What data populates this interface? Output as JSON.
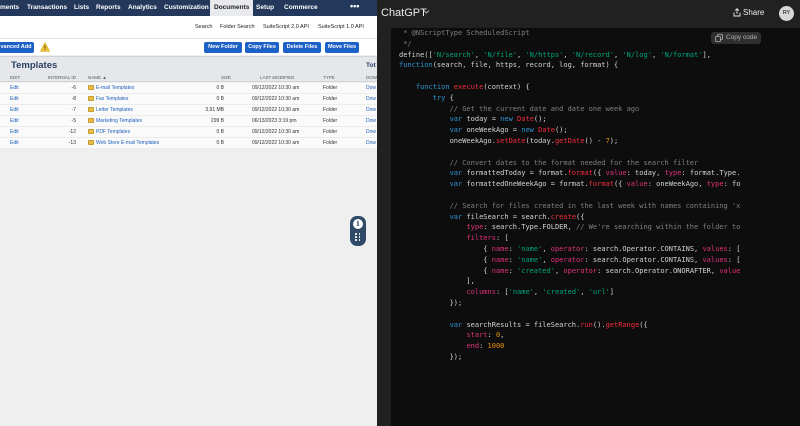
{
  "netsuite": {
    "nav_tabs": [
      "ments",
      "Transactions",
      "Lists",
      "Reports",
      "Analytics",
      "Customization",
      "Documents",
      "Setup",
      "Commerce"
    ],
    "active_tab": "Documents",
    "more_label": "•••",
    "sub_links": [
      "Search",
      "Folder Search",
      "SuiteScript 2.0 API",
      "SuiteScript 1.0 API"
    ],
    "toolbar": {
      "advanced_add": "vanced Add",
      "new_folder": "New Folder",
      "copy_files": "Copy Files",
      "delete_files": "Delete Files",
      "move_files": "Move Files"
    },
    "page_title": "Templates",
    "total_label": "Tot",
    "columns": [
      "EDIT",
      "INTERNAL ID",
      "NAME ▲",
      "SIZE",
      "LAST MODIFIED",
      "TYPE",
      "DOW"
    ],
    "rows": [
      {
        "edit": "Edit",
        "id": "-6",
        "name": "E-mail Templates",
        "size": "0 B",
        "modified": "09/12/2022 10:30 am",
        "type": "Folder",
        "dl": "Dow"
      },
      {
        "edit": "Edit",
        "id": "-8",
        "name": "Fax Templates",
        "size": "0 B",
        "modified": "09/12/2022 10:30 am",
        "type": "Folder",
        "dl": "Dow"
      },
      {
        "edit": "Edit",
        "id": "-7",
        "name": "Letter Templates",
        "size": "3.91 MB",
        "modified": "09/12/2022 10:30 am",
        "type": "Folder",
        "dl": "Dow"
      },
      {
        "edit": "Edit",
        "id": "-5",
        "name": "Marketing Templates",
        "size": "299 B",
        "modified": "06/13/2023 3:19 pm",
        "type": "Folder",
        "dl": "Dow"
      },
      {
        "edit": "Edit",
        "id": "-12",
        "name": "PDF Templates",
        "size": "0 B",
        "modified": "09/12/2022 10:30 am",
        "type": "Folder",
        "dl": "Dow"
      },
      {
        "edit": "Edit",
        "id": "-13",
        "name": "Web Store E-mail Templates",
        "size": "0 B",
        "modified": "09/12/2022 10:30 am",
        "type": "Folder",
        "dl": "Dow"
      }
    ],
    "colors": {
      "nav": "#24385b",
      "button": "#1d60c6",
      "title": "#2a3f62",
      "folder": "#e9bd45"
    }
  },
  "chatgpt": {
    "title": "ChatGPT",
    "share_label": "Share",
    "avatar_initials": "RY",
    "copy_label": "Copy code",
    "code_lines": [
      [
        [
          "c",
          " * @NScriptType ScheduledScript"
        ]
      ],
      [
        [
          "c",
          " */"
        ]
      ],
      [
        [
          "",
          "define(["
        ],
        [
          "s",
          "'N/search'"
        ],
        [
          "",
          ", "
        ],
        [
          "s",
          "'N/file'"
        ],
        [
          "",
          ", "
        ],
        [
          "s",
          "'N/https'"
        ],
        [
          "",
          ", "
        ],
        [
          "s",
          "'N/record'"
        ],
        [
          "",
          ", "
        ],
        [
          "s",
          "'N/log'"
        ],
        [
          "",
          ", "
        ],
        [
          "s",
          "'N/format'"
        ],
        [
          "",
          "], "
        ]
      ],
      [
        [
          "k",
          "function"
        ],
        [
          "",
          "(search, file, https, record, log, format) {"
        ]
      ],
      [
        [
          "",
          ""
        ]
      ],
      [
        [
          "",
          "    "
        ],
        [
          "k",
          "function"
        ],
        [
          "",
          " "
        ],
        [
          "f",
          "execute"
        ],
        [
          "",
          "(context) {"
        ]
      ],
      [
        [
          "",
          "        "
        ],
        [
          "k",
          "try"
        ],
        [
          "",
          " {"
        ]
      ],
      [
        [
          "",
          "            "
        ],
        [
          "c",
          "// Get the current date and date one week ago"
        ]
      ],
      [
        [
          "",
          "            "
        ],
        [
          "k",
          "var"
        ],
        [
          "",
          " today = "
        ],
        [
          "k",
          "new"
        ],
        [
          "",
          " "
        ],
        [
          "f",
          "Date"
        ],
        [
          "",
          "();"
        ]
      ],
      [
        [
          "",
          "            "
        ],
        [
          "k",
          "var"
        ],
        [
          "",
          " oneWeekAgo = "
        ],
        [
          "k",
          "new"
        ],
        [
          "",
          " "
        ],
        [
          "f",
          "Date"
        ],
        [
          "",
          "();"
        ]
      ],
      [
        [
          "",
          "            oneWeekAgo."
        ],
        [
          "f",
          "setDate"
        ],
        [
          "",
          "(today."
        ],
        [
          "f",
          "getDate"
        ],
        [
          "",
          "() - "
        ],
        [
          "p",
          "7"
        ],
        [
          "",
          ");"
        ]
      ],
      [
        [
          "",
          ""
        ]
      ],
      [
        [
          "",
          "            "
        ],
        [
          "c",
          "// Convert dates to the format needed for the search filter"
        ]
      ],
      [
        [
          "",
          "            "
        ],
        [
          "k",
          "var"
        ],
        [
          "",
          " formattedToday = format."
        ],
        [
          "f",
          "format"
        ],
        [
          "",
          "({ "
        ],
        [
          "t",
          "value"
        ],
        [
          "",
          ": today, "
        ],
        [
          "t",
          "type"
        ],
        [
          "",
          ": format.Type."
        ]
      ],
      [
        [
          "",
          "            "
        ],
        [
          "k",
          "var"
        ],
        [
          "",
          " formattedOneWeekAgo = format."
        ],
        [
          "f",
          "format"
        ],
        [
          "",
          "({ "
        ],
        [
          "t",
          "value"
        ],
        [
          "",
          ": oneWeekAgo, "
        ],
        [
          "t",
          "type"
        ],
        [
          "",
          ": fo"
        ]
      ],
      [
        [
          "",
          ""
        ]
      ],
      [
        [
          "",
          "            "
        ],
        [
          "c",
          "// Search for files created in the last week with names containing 'x"
        ]
      ],
      [
        [
          "",
          "            "
        ],
        [
          "k",
          "var"
        ],
        [
          "",
          " fileSearch = search."
        ],
        [
          "f",
          "create"
        ],
        [
          "",
          "({"
        ]
      ],
      [
        [
          "",
          "                "
        ],
        [
          "t",
          "type"
        ],
        [
          "",
          ": search.Type.FOLDER, "
        ],
        [
          "c",
          "// We're searching within the folder to"
        ]
      ],
      [
        [
          "",
          "                "
        ],
        [
          "t",
          "filters"
        ],
        [
          "",
          ": ["
        ]
      ],
      [
        [
          "",
          "                    { "
        ],
        [
          "t",
          "name"
        ],
        [
          "",
          ": "
        ],
        [
          "s",
          "'name'"
        ],
        [
          "",
          ", "
        ],
        [
          "t",
          "operator"
        ],
        [
          "",
          ": search.Operator.CONTAINS, "
        ],
        [
          "t",
          "values"
        ],
        [
          "",
          ": ["
        ]
      ],
      [
        [
          "",
          "                    { "
        ],
        [
          "t",
          "name"
        ],
        [
          "",
          ": "
        ],
        [
          "s",
          "'name'"
        ],
        [
          "",
          ", "
        ],
        [
          "t",
          "operator"
        ],
        [
          "",
          ": search.Operator.CONTAINS, "
        ],
        [
          "t",
          "values"
        ],
        [
          "",
          ": ["
        ]
      ],
      [
        [
          "",
          "                    { "
        ],
        [
          "t",
          "name"
        ],
        [
          "",
          ": "
        ],
        [
          "s",
          "'created'"
        ],
        [
          "",
          ", "
        ],
        [
          "t",
          "operator"
        ],
        [
          "",
          ": search.Operator.ONORAFTER, "
        ],
        [
          "t",
          "value"
        ]
      ],
      [
        [
          "",
          "                ],"
        ]
      ],
      [
        [
          "",
          "                "
        ],
        [
          "t",
          "columns"
        ],
        [
          "",
          ": ["
        ],
        [
          "s",
          "'name'"
        ],
        [
          "",
          ", "
        ],
        [
          "s",
          "'created'"
        ],
        [
          "",
          ", "
        ],
        [
          "s",
          "'url'"
        ],
        [
          "",
          "]"
        ]
      ],
      [
        [
          "",
          "            });"
        ]
      ],
      [
        [
          "",
          ""
        ]
      ],
      [
        [
          "",
          "            "
        ],
        [
          "k",
          "var"
        ],
        [
          "",
          " searchResults = fileSearch."
        ],
        [
          "f",
          "run"
        ],
        [
          "",
          "()."
        ],
        [
          "f",
          "getRange"
        ],
        [
          "",
          "({"
        ]
      ],
      [
        [
          "",
          "                "
        ],
        [
          "t",
          "start"
        ],
        [
          "",
          ": "
        ],
        [
          "p",
          "0"
        ],
        [
          "",
          ","
        ]
      ],
      [
        [
          "",
          "                "
        ],
        [
          "t",
          "end"
        ],
        [
          "",
          ": "
        ],
        [
          "p",
          "1000"
        ]
      ],
      [
        [
          "",
          "            });"
        ]
      ]
    ],
    "colors": {
      "background": "#212121",
      "code_bg": "#0d0d0d",
      "keyword": "#2e95d3",
      "string": "#00a67d",
      "function": "#f22c3d",
      "property": "#df3079",
      "number": "#e9950c",
      "comment": "#7b8084"
    }
  }
}
